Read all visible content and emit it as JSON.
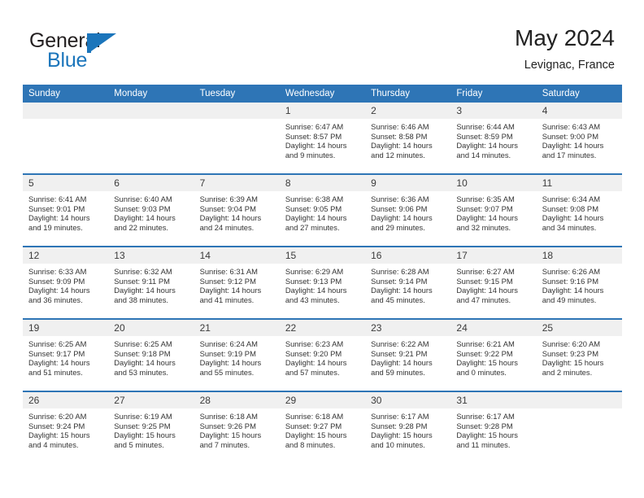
{
  "brand": {
    "name_part1": "General",
    "name_part2": "Blue",
    "logo_icon": "flag-triangle-icon"
  },
  "header": {
    "title": "May 2024",
    "subtitle": "Levignac, France"
  },
  "colors": {
    "header_blue": "#2e75b6",
    "brand_blue": "#1b75bb",
    "daynum_band": "#f0f0f0",
    "text": "#333333"
  },
  "weekdays": [
    "Sunday",
    "Monday",
    "Tuesday",
    "Wednesday",
    "Thursday",
    "Friday",
    "Saturday"
  ],
  "weeks": [
    {
      "days": [
        {
          "num": "",
          "sunrise": "",
          "sunset": "",
          "daylight_l1": "",
          "daylight_l2": ""
        },
        {
          "num": "",
          "sunrise": "",
          "sunset": "",
          "daylight_l1": "",
          "daylight_l2": ""
        },
        {
          "num": "",
          "sunrise": "",
          "sunset": "",
          "daylight_l1": "",
          "daylight_l2": ""
        },
        {
          "num": "1",
          "sunrise": "Sunrise: 6:47 AM",
          "sunset": "Sunset: 8:57 PM",
          "daylight_l1": "Daylight: 14 hours",
          "daylight_l2": "and 9 minutes."
        },
        {
          "num": "2",
          "sunrise": "Sunrise: 6:46 AM",
          "sunset": "Sunset: 8:58 PM",
          "daylight_l1": "Daylight: 14 hours",
          "daylight_l2": "and 12 minutes."
        },
        {
          "num": "3",
          "sunrise": "Sunrise: 6:44 AM",
          "sunset": "Sunset: 8:59 PM",
          "daylight_l1": "Daylight: 14 hours",
          "daylight_l2": "and 14 minutes."
        },
        {
          "num": "4",
          "sunrise": "Sunrise: 6:43 AM",
          "sunset": "Sunset: 9:00 PM",
          "daylight_l1": "Daylight: 14 hours",
          "daylight_l2": "and 17 minutes."
        }
      ]
    },
    {
      "days": [
        {
          "num": "5",
          "sunrise": "Sunrise: 6:41 AM",
          "sunset": "Sunset: 9:01 PM",
          "daylight_l1": "Daylight: 14 hours",
          "daylight_l2": "and 19 minutes."
        },
        {
          "num": "6",
          "sunrise": "Sunrise: 6:40 AM",
          "sunset": "Sunset: 9:03 PM",
          "daylight_l1": "Daylight: 14 hours",
          "daylight_l2": "and 22 minutes."
        },
        {
          "num": "7",
          "sunrise": "Sunrise: 6:39 AM",
          "sunset": "Sunset: 9:04 PM",
          "daylight_l1": "Daylight: 14 hours",
          "daylight_l2": "and 24 minutes."
        },
        {
          "num": "8",
          "sunrise": "Sunrise: 6:38 AM",
          "sunset": "Sunset: 9:05 PM",
          "daylight_l1": "Daylight: 14 hours",
          "daylight_l2": "and 27 minutes."
        },
        {
          "num": "9",
          "sunrise": "Sunrise: 6:36 AM",
          "sunset": "Sunset: 9:06 PM",
          "daylight_l1": "Daylight: 14 hours",
          "daylight_l2": "and 29 minutes."
        },
        {
          "num": "10",
          "sunrise": "Sunrise: 6:35 AM",
          "sunset": "Sunset: 9:07 PM",
          "daylight_l1": "Daylight: 14 hours",
          "daylight_l2": "and 32 minutes."
        },
        {
          "num": "11",
          "sunrise": "Sunrise: 6:34 AM",
          "sunset": "Sunset: 9:08 PM",
          "daylight_l1": "Daylight: 14 hours",
          "daylight_l2": "and 34 minutes."
        }
      ]
    },
    {
      "days": [
        {
          "num": "12",
          "sunrise": "Sunrise: 6:33 AM",
          "sunset": "Sunset: 9:09 PM",
          "daylight_l1": "Daylight: 14 hours",
          "daylight_l2": "and 36 minutes."
        },
        {
          "num": "13",
          "sunrise": "Sunrise: 6:32 AM",
          "sunset": "Sunset: 9:11 PM",
          "daylight_l1": "Daylight: 14 hours",
          "daylight_l2": "and 38 minutes."
        },
        {
          "num": "14",
          "sunrise": "Sunrise: 6:31 AM",
          "sunset": "Sunset: 9:12 PM",
          "daylight_l1": "Daylight: 14 hours",
          "daylight_l2": "and 41 minutes."
        },
        {
          "num": "15",
          "sunrise": "Sunrise: 6:29 AM",
          "sunset": "Sunset: 9:13 PM",
          "daylight_l1": "Daylight: 14 hours",
          "daylight_l2": "and 43 minutes."
        },
        {
          "num": "16",
          "sunrise": "Sunrise: 6:28 AM",
          "sunset": "Sunset: 9:14 PM",
          "daylight_l1": "Daylight: 14 hours",
          "daylight_l2": "and 45 minutes."
        },
        {
          "num": "17",
          "sunrise": "Sunrise: 6:27 AM",
          "sunset": "Sunset: 9:15 PM",
          "daylight_l1": "Daylight: 14 hours",
          "daylight_l2": "and 47 minutes."
        },
        {
          "num": "18",
          "sunrise": "Sunrise: 6:26 AM",
          "sunset": "Sunset: 9:16 PM",
          "daylight_l1": "Daylight: 14 hours",
          "daylight_l2": "and 49 minutes."
        }
      ]
    },
    {
      "days": [
        {
          "num": "19",
          "sunrise": "Sunrise: 6:25 AM",
          "sunset": "Sunset: 9:17 PM",
          "daylight_l1": "Daylight: 14 hours",
          "daylight_l2": "and 51 minutes."
        },
        {
          "num": "20",
          "sunrise": "Sunrise: 6:25 AM",
          "sunset": "Sunset: 9:18 PM",
          "daylight_l1": "Daylight: 14 hours",
          "daylight_l2": "and 53 minutes."
        },
        {
          "num": "21",
          "sunrise": "Sunrise: 6:24 AM",
          "sunset": "Sunset: 9:19 PM",
          "daylight_l1": "Daylight: 14 hours",
          "daylight_l2": "and 55 minutes."
        },
        {
          "num": "22",
          "sunrise": "Sunrise: 6:23 AM",
          "sunset": "Sunset: 9:20 PM",
          "daylight_l1": "Daylight: 14 hours",
          "daylight_l2": "and 57 minutes."
        },
        {
          "num": "23",
          "sunrise": "Sunrise: 6:22 AM",
          "sunset": "Sunset: 9:21 PM",
          "daylight_l1": "Daylight: 14 hours",
          "daylight_l2": "and 59 minutes."
        },
        {
          "num": "24",
          "sunrise": "Sunrise: 6:21 AM",
          "sunset": "Sunset: 9:22 PM",
          "daylight_l1": "Daylight: 15 hours",
          "daylight_l2": "and 0 minutes."
        },
        {
          "num": "25",
          "sunrise": "Sunrise: 6:20 AM",
          "sunset": "Sunset: 9:23 PM",
          "daylight_l1": "Daylight: 15 hours",
          "daylight_l2": "and 2 minutes."
        }
      ]
    },
    {
      "days": [
        {
          "num": "26",
          "sunrise": "Sunrise: 6:20 AM",
          "sunset": "Sunset: 9:24 PM",
          "daylight_l1": "Daylight: 15 hours",
          "daylight_l2": "and 4 minutes."
        },
        {
          "num": "27",
          "sunrise": "Sunrise: 6:19 AM",
          "sunset": "Sunset: 9:25 PM",
          "daylight_l1": "Daylight: 15 hours",
          "daylight_l2": "and 5 minutes."
        },
        {
          "num": "28",
          "sunrise": "Sunrise: 6:18 AM",
          "sunset": "Sunset: 9:26 PM",
          "daylight_l1": "Daylight: 15 hours",
          "daylight_l2": "and 7 minutes."
        },
        {
          "num": "29",
          "sunrise": "Sunrise: 6:18 AM",
          "sunset": "Sunset: 9:27 PM",
          "daylight_l1": "Daylight: 15 hours",
          "daylight_l2": "and 8 minutes."
        },
        {
          "num": "30",
          "sunrise": "Sunrise: 6:17 AM",
          "sunset": "Sunset: 9:28 PM",
          "daylight_l1": "Daylight: 15 hours",
          "daylight_l2": "and 10 minutes."
        },
        {
          "num": "31",
          "sunrise": "Sunrise: 6:17 AM",
          "sunset": "Sunset: 9:28 PM",
          "daylight_l1": "Daylight: 15 hours",
          "daylight_l2": "and 11 minutes."
        },
        {
          "num": "",
          "sunrise": "",
          "sunset": "",
          "daylight_l1": "",
          "daylight_l2": ""
        }
      ]
    }
  ]
}
